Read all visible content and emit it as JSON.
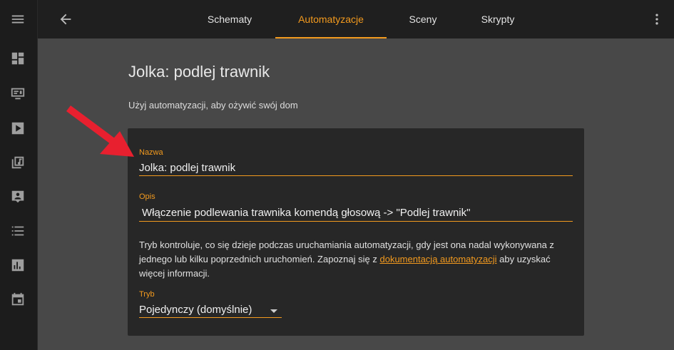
{
  "tabs": [
    {
      "label": "Schematy",
      "active": false
    },
    {
      "label": "Automatyzacje",
      "active": true
    },
    {
      "label": "Sceny",
      "active": false
    },
    {
      "label": "Skrypty",
      "active": false
    }
  ],
  "page": {
    "title": "Jolka: podlej trawnik",
    "intro": "Użyj automatyzacji, aby ożywić swój dom"
  },
  "form": {
    "name_label": "Nazwa",
    "name_value": "Jolka: podlej trawnik",
    "desc_label": "Opis",
    "desc_value": "Włączenie podlewania trawnika komendą głosową -> \"Podlej trawnik\"",
    "help_before": "Tryb kontroluje, co się dzieje podczas uruchamiania automatyzacji, gdy jest ona nadal wykonywana z jednego lub kilku poprzednich uruchomień. Zapoznaj się z ",
    "help_link": "dokumentacją automatyzacji",
    "help_after": " aby uzyskać więcej informacji.",
    "mode_label": "Tryb",
    "mode_value": "Pojedynczy (domyślnie)"
  },
  "colors": {
    "accent": "#f39a1e",
    "annotation_arrow": "#e8202f"
  },
  "sidebar_icons": [
    "menu-icon",
    "dashboard-icon",
    "monitor-icon",
    "media-play-icon",
    "music-library-icon",
    "account-box-icon",
    "list-icon",
    "chart-icon",
    "calendar-icon"
  ]
}
